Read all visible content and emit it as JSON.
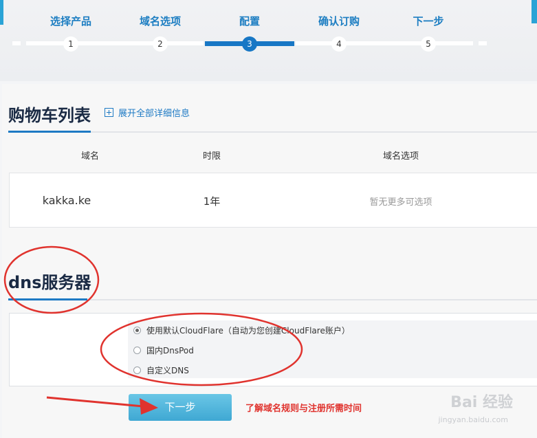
{
  "steps": [
    {
      "number": "1",
      "label": "选择产品"
    },
    {
      "number": "2",
      "label": "域名选项"
    },
    {
      "number": "3",
      "label": "配置"
    },
    {
      "number": "4",
      "label": "确认订购"
    },
    {
      "number": "5",
      "label": "下一步"
    }
  ],
  "active_step": 3,
  "cart": {
    "title": "购物车列表",
    "expand_label": "展开全部详细信息",
    "columns": [
      "域名",
      "时限",
      "域名选项"
    ],
    "rows": [
      {
        "domain": "kakka.ke",
        "period": "1年",
        "options": "暂无更多可选项"
      }
    ]
  },
  "dns": {
    "title": "dns服务器",
    "options": [
      {
        "label": "使用默认CloudFlare（自动为您创建CloudFlare账户）",
        "checked": true
      },
      {
        "label": "国内DnsPod",
        "checked": false
      },
      {
        "label": "自定义DNS",
        "checked": false
      }
    ]
  },
  "actions": {
    "next_label": "下一步",
    "rules_link": "了解域名规则与注册所需时间"
  },
  "watermark": {
    "brand": "Bai 经验",
    "url": "jingyan.baidu.com"
  },
  "colors": {
    "accent": "#1877c5",
    "annotation_red": "#e0332e",
    "button": "#4ab2da"
  }
}
